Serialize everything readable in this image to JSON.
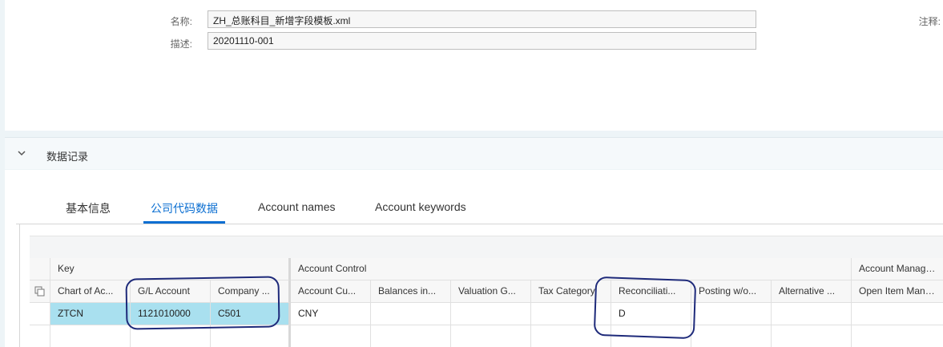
{
  "form": {
    "name_label": "名称:",
    "name_value": "ZH_总账科目_新增字段模板.xml",
    "desc_label": "描述:",
    "desc_value": "20201110-001",
    "note_label": "注释:"
  },
  "section": {
    "title": "数据记录"
  },
  "tabs": [
    {
      "label": "基本信息",
      "active": false
    },
    {
      "label": "公司代码数据",
      "active": true
    },
    {
      "label": "Account names",
      "active": false
    },
    {
      "label": "Account keywords",
      "active": false
    }
  ],
  "table": {
    "groups": [
      "Key",
      "Account Control",
      "Account Manageme"
    ],
    "headers": [
      "Chart of Ac...",
      "G/L Account",
      "Company ...",
      "Account Cu...",
      "Balances in...",
      "Valuation G...",
      "Tax Category",
      "Reconciliati...",
      "Posting w/o...",
      "Alternative ...",
      "Open Item Manager"
    ],
    "rows": [
      [
        "ZTCN",
        "1121010000",
        "C501",
        "CNY",
        "",
        "",
        "",
        "D",
        "",
        "",
        ""
      ],
      [
        "",
        "",
        "",
        "",
        "",
        "",
        "",
        "",
        "",
        "",
        ""
      ]
    ]
  },
  "colors": {
    "accent": "#0a6ed1",
    "selected_row": "#a9e0ef",
    "annotation": "#1e2a7a"
  }
}
